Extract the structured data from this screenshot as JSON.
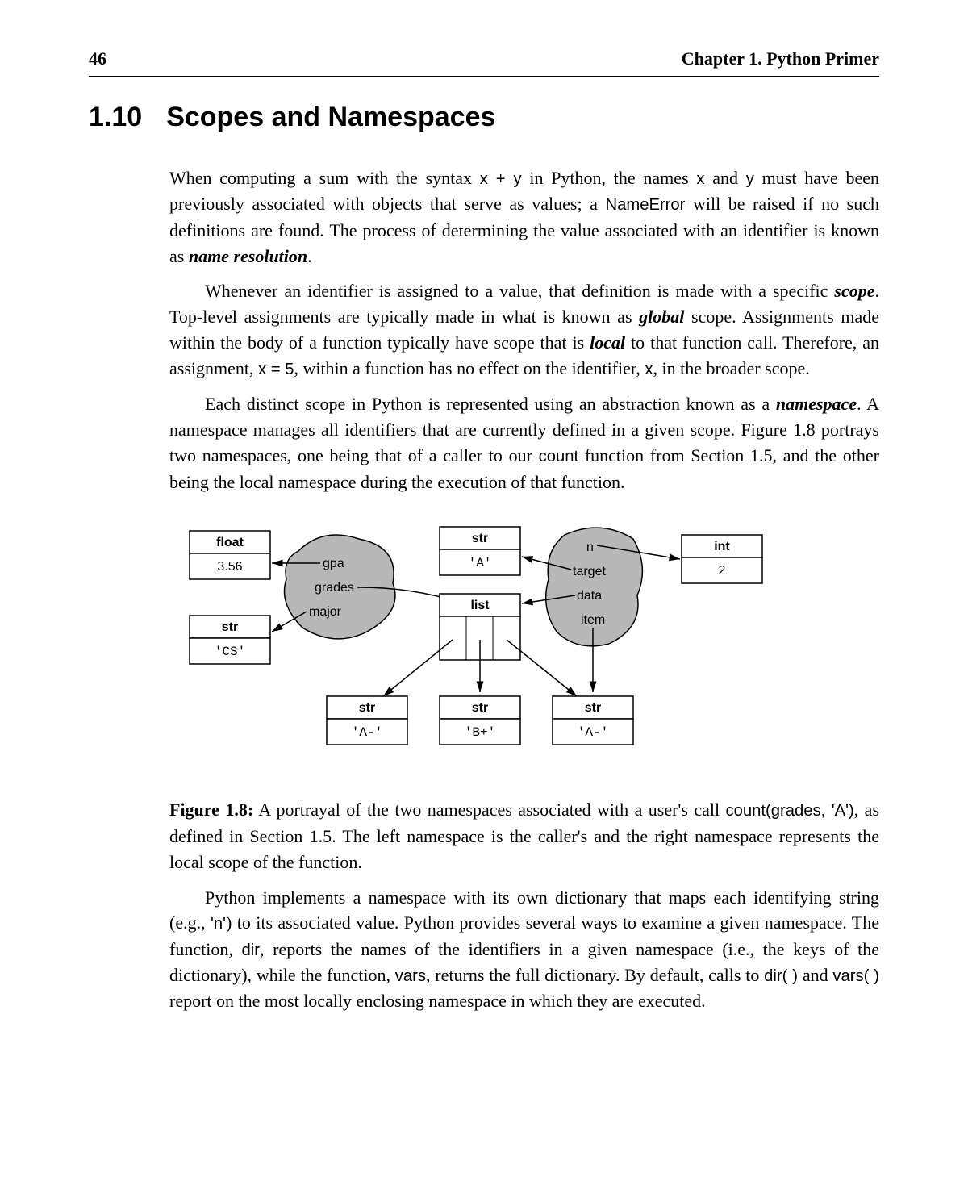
{
  "header": {
    "page_number": "46",
    "chapter_label": "Chapter 1.   Python Primer"
  },
  "section": {
    "number": "1.10",
    "title": "Scopes and Namespaces"
  },
  "paragraphs": {
    "p1_a": "When computing a sum with the syntax ",
    "p1_expr": "x + y",
    "p1_b": " in Python, the names ",
    "p1_x": "x",
    "p1_c": " and ",
    "p1_y": "y",
    "p1_d": " must have been previously associated with objects that serve as values; a ",
    "p1_err": "NameError",
    "p1_e": " will be raised if no such definitions are found.  The process of determining the value associated with an identifier is known as ",
    "p1_term": "name resolution",
    "p1_f": ".",
    "p2_a": "Whenever an identifier is assigned to a value, that definition is made with a specific ",
    "p2_scope": "scope",
    "p2_b": ". Top-level assignments are typically made in what is known as ",
    "p2_global": "global",
    "p2_c": " scope. Assignments made within the body of a function typically have scope that is ",
    "p2_local": "local",
    "p2_d": " to that function call. Therefore, an assignment, ",
    "p2_assign": "x = 5",
    "p2_e": ", within a function has no effect on the identifier, ",
    "p2_x": "x",
    "p2_f": ", in the broader scope.",
    "p3_a": "Each distinct scope in Python is represented using an abstraction known as a ",
    "p3_ns": "namespace",
    "p3_b": ".  A namespace manages all identifiers that are currently defined in a given scope. Figure 1.8 portrays two namespaces, one being that of a caller to our ",
    "p3_count": "count",
    "p3_c": " function from Section 1.5, and the other being the local namespace during the execution of that function.",
    "p4_a": "Python implements a namespace with its own dictionary that maps each identifying string (e.g., ",
    "p4_n": "'n'",
    "p4_b": ") to its associated value.  Python provides several ways to examine a given namespace. The function, ",
    "p4_dir": "dir",
    "p4_c": ", reports the names of the identifiers in a given namespace (i.e., the keys of the dictionary), while the function, ",
    "p4_vars": "vars",
    "p4_d": ", returns the full dictionary. By default, calls to ",
    "p4_dircall": "dir( )",
    "p4_e": " and ",
    "p4_varscall": "vars( )",
    "p4_f": " report on the most locally enclosing namespace in which they are executed."
  },
  "diagram": {
    "float_label": "float",
    "float_value": "3.56",
    "str_label": "str",
    "cs_value": "'CS'",
    "a_value": "'A'",
    "list_label": "list",
    "int_label": "int",
    "int_value": "2",
    "am_value": "'A-'",
    "bp_value": "'B+'",
    "am2_value": "'A-'",
    "left_blob": {
      "gpa": "gpa",
      "grades": "grades",
      "major": "major"
    },
    "right_blob": {
      "n": "n",
      "target": "target",
      "data": "data",
      "item": "item"
    }
  },
  "caption": {
    "fignum": "Figure 1.8:",
    "text_a": "  A portrayal of the two namespaces associated with a user's call ",
    "call": "count(grades, 'A')",
    "text_b": ", as defined in Section 1.5.  The left namespace is the caller's and the right namespace represents the local scope of the function."
  }
}
